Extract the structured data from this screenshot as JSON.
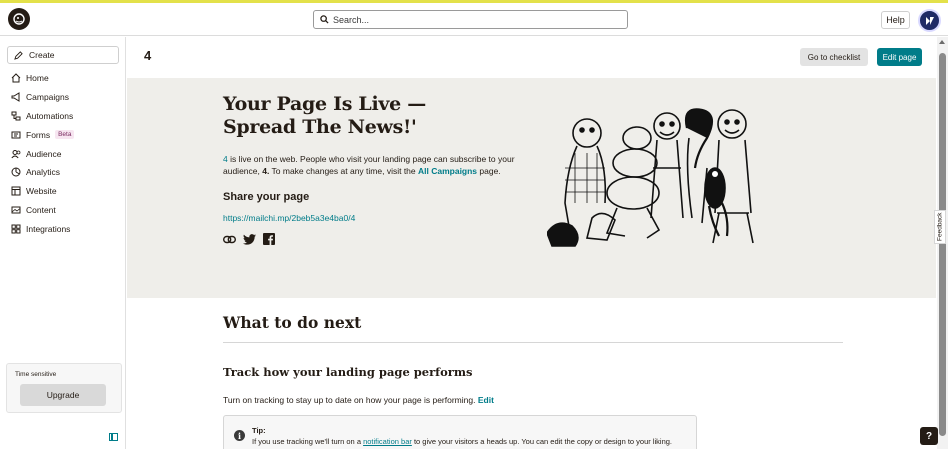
{
  "topbar": {
    "search_placeholder": "Search...",
    "help_label": "Help"
  },
  "sidebar": {
    "create_label": "Create",
    "items": [
      {
        "label": "Home"
      },
      {
        "label": "Campaigns"
      },
      {
        "label": "Automations"
      },
      {
        "label": "Forms",
        "badge": "Beta"
      },
      {
        "label": "Audience"
      },
      {
        "label": "Analytics"
      },
      {
        "label": "Website"
      },
      {
        "label": "Content"
      },
      {
        "label": "Integrations"
      }
    ],
    "time_sensitive_label": "Time sensitive",
    "upgrade_label": "Upgrade"
  },
  "main": {
    "page_name": "4",
    "checklist_label": "Go to checklist",
    "edit_page_label": "Edit page",
    "hero": {
      "title_line1": "Your Page Is Live —",
      "title_line2": "Spread The News!'",
      "text_page": "4",
      "text_part1": " is live on the web. People who visit your landing page can subscribe to your audience, ",
      "text_audience": "4.",
      "text_part2": " To make changes at any time, visit the ",
      "text_link": "All Campaigns",
      "text_part3": " page.",
      "share_heading": "Share your page",
      "share_url": "https://mailchi.mp/2beb5a3e4ba0/4"
    },
    "next_heading": "What to do next",
    "track_heading": "Track how your landing page performs",
    "track_text": "Turn on tracking to stay up to date on how your page is performing.",
    "track_edit": "Edit",
    "tip": {
      "label": "Tip:",
      "text_part1": "If you use tracking we'll turn on a ",
      "link": "notification bar",
      "text_part2": " to give your visitors a heads up. You can edit the copy or design to your liking."
    }
  },
  "feedback_label": "Feedback",
  "help_fab_label": "?",
  "colors": {
    "accent": "#007c89",
    "hero_bg": "#efeeea",
    "dark": "#241c15",
    "topline": "#e3e14a"
  }
}
